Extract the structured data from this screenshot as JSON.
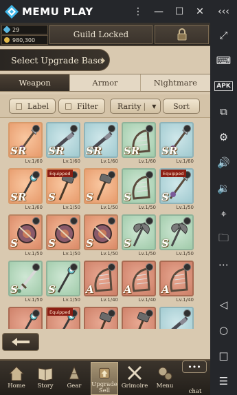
{
  "emulator": {
    "brand": "MEMU PLAY",
    "controls": [
      "more-vertical-icon",
      "minimize-icon",
      "maximize-icon",
      "close-icon",
      "collapse-icon"
    ],
    "sidebar": [
      "fullscreen-icon",
      "keyboard-icon",
      "apk-icon",
      "multi-window-icon",
      "settings-icon",
      "volume-up-icon",
      "volume-down-icon",
      "location-icon",
      "folder-icon",
      "more-horizontal-icon",
      "back-icon",
      "home-icon",
      "recent-apps-icon",
      "menu-lines-icon"
    ],
    "apk_label": "APK"
  },
  "header": {
    "gems": "29",
    "gold": "980,300",
    "guild": "Guild Locked"
  },
  "page_title": "Select Upgrade Base",
  "tabs": [
    {
      "label": "Weapon",
      "active": true
    },
    {
      "label": "Armor",
      "active": false
    },
    {
      "label": "Nightmare",
      "active": false
    }
  ],
  "filters": {
    "label_btn": "Label",
    "filter_btn": "Filter",
    "rarity_btn": "Rarity",
    "rarity_sep": "|",
    "rarity_arrow": "▼",
    "sort_btn": "Sort"
  },
  "cards": [
    {
      "rank": "SR",
      "lv": "Lv.1/60",
      "color": "sr",
      "weapon": "spear",
      "equipped": ""
    },
    {
      "rank": "SR",
      "lv": "Lv.1/60",
      "color": "s-blue",
      "weapon": "gun",
      "equipped": ""
    },
    {
      "rank": "SR",
      "lv": "Lv.1/60",
      "color": "s-blue",
      "weapon": "gun",
      "equipped": ""
    },
    {
      "rank": "SR",
      "lv": "Lv.1/60",
      "color": "s-green",
      "weapon": "harp",
      "equipped": ""
    },
    {
      "rank": "SR",
      "lv": "Lv.1/60",
      "color": "s-blue",
      "weapon": "spear",
      "equipped": ""
    },
    {
      "rank": "SR",
      "lv": "Lv.1/60",
      "color": "sr",
      "weapon": "staff",
      "equipped": ""
    },
    {
      "rank": "S",
      "lv": "Lv.1/50",
      "color": "sr",
      "weapon": "hammer",
      "equipped": "Equipped"
    },
    {
      "rank": "S",
      "lv": "Lv.1/50",
      "color": "sr",
      "weapon": "hammer",
      "equipped": ""
    },
    {
      "rank": "S",
      "lv": "Lv.1/50",
      "color": "s-green",
      "weapon": "harp",
      "equipped": ""
    },
    {
      "rank": "S",
      "lv": "Lv.1/50",
      "color": "s-blue",
      "weapon": "spear",
      "equipped": "Equipped"
    },
    {
      "rank": "S",
      "lv": "Lv.1/50",
      "color": "s-orange",
      "weapon": "tome",
      "equipped": ""
    },
    {
      "rank": "S",
      "lv": "Lv.1/50",
      "color": "s-orange",
      "weapon": "tome",
      "equipped": ""
    },
    {
      "rank": "S",
      "lv": "Lv.1/50",
      "color": "s-orange",
      "weapon": "tome",
      "equipped": ""
    },
    {
      "rank": "S",
      "lv": "Lv.1/50",
      "color": "s-green",
      "weapon": "axe",
      "equipped": ""
    },
    {
      "rank": "S",
      "lv": "Lv.1/50",
      "color": "s-green",
      "weapon": "axe",
      "equipped": ""
    },
    {
      "rank": "S",
      "lv": "Lv.1/50",
      "color": "s-green",
      "weapon": "sword",
      "equipped": ""
    },
    {
      "rank": "S",
      "lv": "Lv.1/50",
      "color": "s-green",
      "weapon": "staff",
      "equipped": ""
    },
    {
      "rank": "A",
      "lv": "Lv.1/40",
      "color": "a-red",
      "weapon": "harp",
      "equipped": ""
    },
    {
      "rank": "A",
      "lv": "Lv.1/40",
      "color": "a-red",
      "weapon": "harp",
      "equipped": ""
    },
    {
      "rank": "A",
      "lv": "Lv.1/40",
      "color": "a-red",
      "weapon": "harp",
      "equipped": ""
    },
    {
      "rank": "",
      "lv": "",
      "color": "a-red",
      "weapon": "staff",
      "equipped": ""
    },
    {
      "rank": "",
      "lv": "",
      "color": "a-red",
      "weapon": "staff",
      "equipped": "Equipped"
    },
    {
      "rank": "",
      "lv": "",
      "color": "a-red",
      "weapon": "hammer",
      "equipped": ""
    },
    {
      "rank": "",
      "lv": "",
      "color": "a-red",
      "weapon": "hammer",
      "equipped": ""
    },
    {
      "rank": "",
      "lv": "",
      "color": "s-blue",
      "weapon": "gun",
      "equipped": ""
    }
  ],
  "nav": [
    {
      "label": "Home",
      "icon": "home-icon",
      "active": false
    },
    {
      "label": "Story",
      "icon": "book-icon",
      "active": false
    },
    {
      "label": "Gear",
      "icon": "gear-icon",
      "active": false
    },
    {
      "label": "Upgrade\nSell",
      "icon": "upgrade-icon",
      "active": true
    },
    {
      "label": "Grimoire",
      "icon": "swords-icon",
      "active": false
    },
    {
      "label": "Menu",
      "icon": "cogs-icon",
      "active": false
    },
    {
      "label": "chat",
      "icon": "chat-icon",
      "active": false
    }
  ],
  "chat_dots": "•••"
}
